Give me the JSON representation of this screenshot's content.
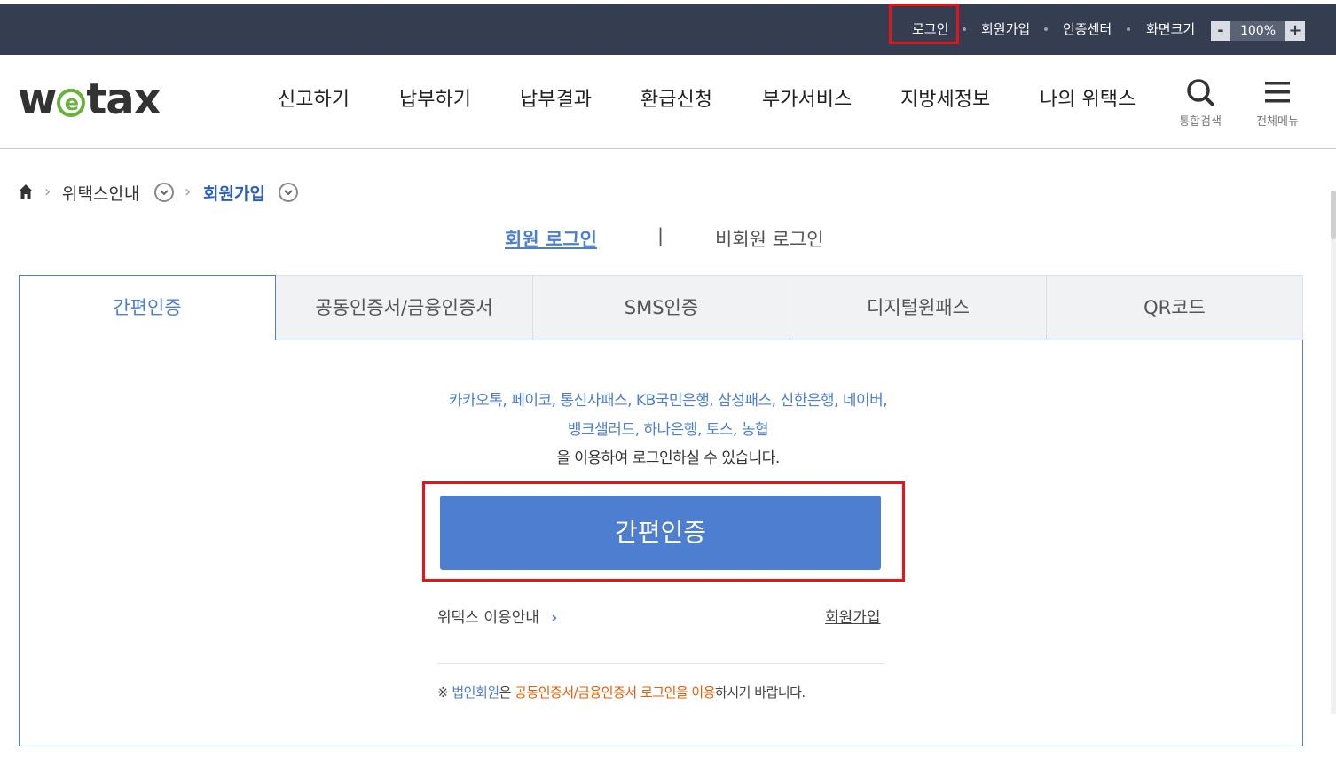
{
  "topbar": {
    "login": "로그인",
    "signup": "회원가입",
    "cert_center": "인증센터",
    "screen_size": "화면크기",
    "zoom_minus": "-",
    "zoom_value": "100%",
    "zoom_plus": "+"
  },
  "header": {
    "logo_left": "w",
    "logo_e": "e",
    "logo_right": "tax",
    "nav": [
      "신고하기",
      "납부하기",
      "납부결과",
      "환급신청",
      "부가서비스",
      "지방세정보",
      "나의 위택스"
    ],
    "search_label": "통합검색",
    "menu_label": "전체메뉴"
  },
  "breadcrumb": {
    "level1": "위택스안내",
    "level2": "회원가입"
  },
  "login_tabs": {
    "member": "회원 로그인",
    "separator": "|",
    "guest": "비회원 로그인"
  },
  "method_tabs": [
    "간편인증",
    "공동인증서/금융인증서",
    "SMS인증",
    "디지털원패스",
    "QR코드"
  ],
  "panel": {
    "providers_line1": "카카오톡, 페이코, 통신사패스, KB국민은행, 삼성패스, 신한은행, 네이버,",
    "providers_line2": "뱅크샐러드, 하나은행, 토스, 농협",
    "description": "을 이용하여 로그인하실 수 있습니다.",
    "button_label": "간편인증",
    "info_link": "위택스 이용안내",
    "info_chevron": "›",
    "join_link": "회원가입",
    "notice_mark": "※",
    "notice_part1": "법인회원",
    "notice_part2": "은 ",
    "notice_part3": "공동인증서/금융인증서 로그인을 이용",
    "notice_part4": "하시기 바랍니다."
  },
  "colors": {
    "topbar_bg": "#353d51",
    "accent_blue": "#4e7ecf",
    "highlight_red": "#e5141a",
    "notice_orange": "#e0600a",
    "logo_green": "#6ab23e"
  }
}
